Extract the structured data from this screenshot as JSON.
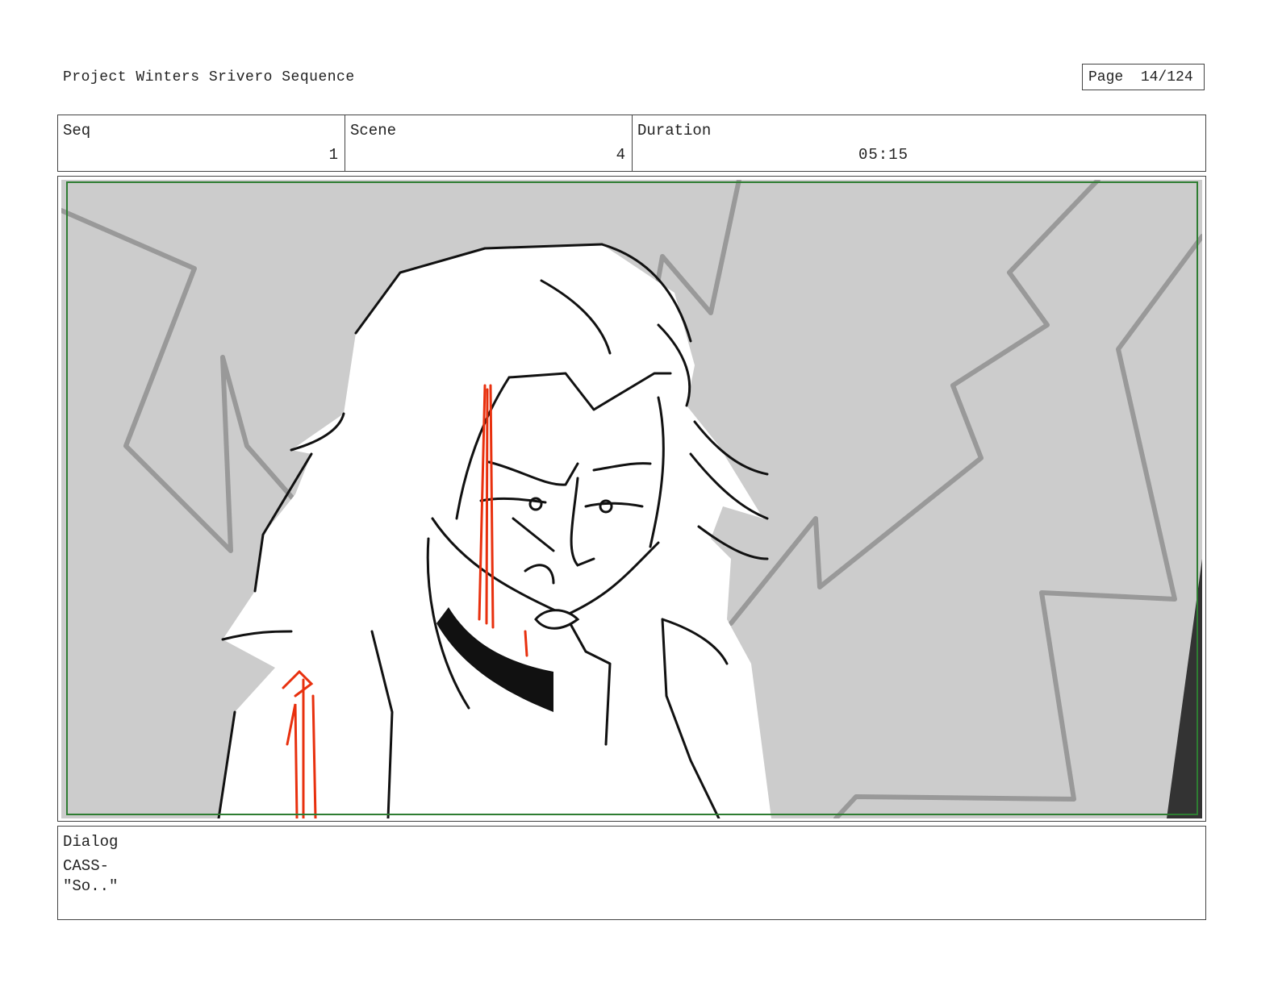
{
  "header": {
    "project_title": "Project Winters Srivero Sequence",
    "page_label": "Page",
    "page_number": "14/124"
  },
  "info": {
    "seq_label": "Seq",
    "seq_value": "1",
    "scene_label": "Scene",
    "scene_value": "4",
    "duration_label": "Duration",
    "duration_value": "05:15"
  },
  "panel": {
    "image": "storyboard-sketch-character-closeup",
    "colors": {
      "background": "#cccccc",
      "background_lines": "#999999",
      "ink": "#111111",
      "blood": "#e8300e",
      "safe_frame": "#2e7d32"
    }
  },
  "dialog": {
    "label": "Dialog",
    "lines": [
      "CASS-",
      "\"So..\""
    ]
  }
}
